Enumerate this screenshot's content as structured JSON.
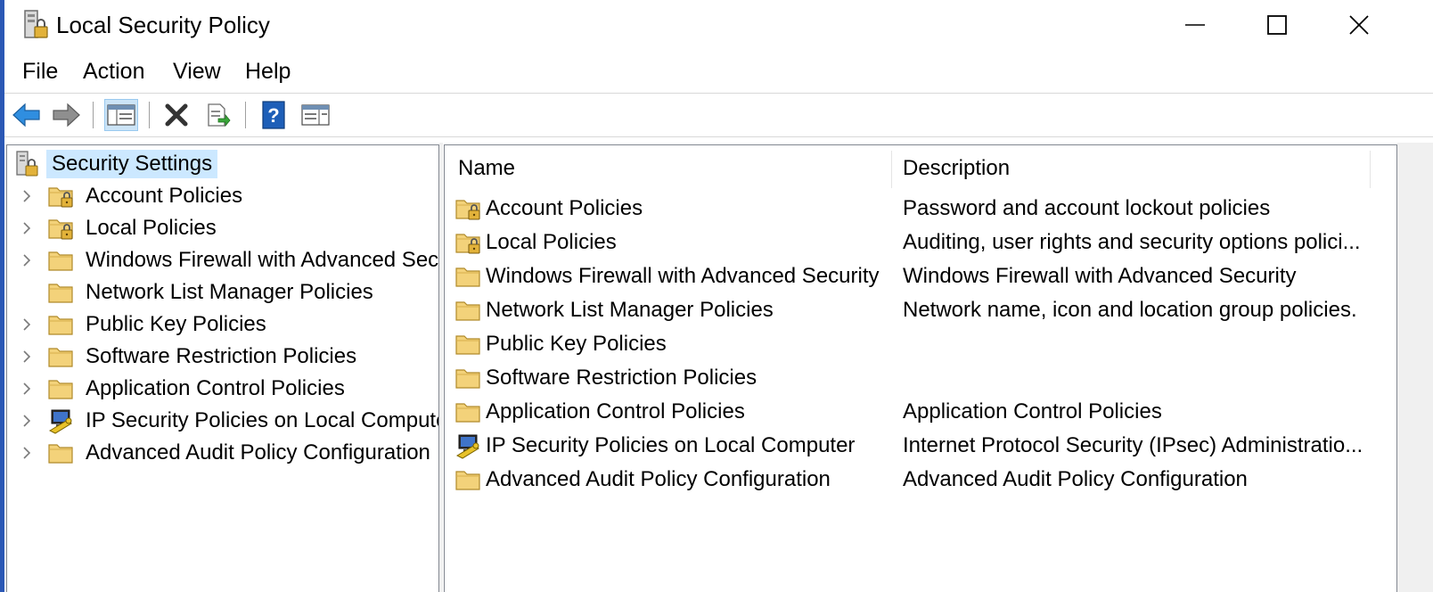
{
  "window": {
    "title": "Local Security Policy"
  },
  "menu": [
    "File",
    "Action",
    "View",
    "Help"
  ],
  "toolbar": {
    "buttons": [
      "back-icon",
      "forward-icon",
      "show-hide-console-tree-icon",
      "delete-icon",
      "export-list-icon",
      "help-icon",
      "properties-view-icon"
    ]
  },
  "tree": {
    "root": "Security Settings",
    "items": [
      {
        "label": "Account Policies",
        "expandable": true,
        "icon": "folder-lock-icon"
      },
      {
        "label": "Local Policies",
        "expandable": true,
        "icon": "folder-lock-icon"
      },
      {
        "label": "Windows Firewall with Advanced Secu",
        "expandable": true,
        "icon": "folder-icon"
      },
      {
        "label": "Network List Manager Policies",
        "expandable": false,
        "icon": "folder-icon"
      },
      {
        "label": "Public Key Policies",
        "expandable": true,
        "icon": "folder-icon"
      },
      {
        "label": "Software Restriction Policies",
        "expandable": true,
        "icon": "folder-icon"
      },
      {
        "label": "Application Control Policies",
        "expandable": true,
        "icon": "folder-icon"
      },
      {
        "label": "IP Security Policies on Local Compute",
        "expandable": true,
        "icon": "ip-security-icon"
      },
      {
        "label": "Advanced Audit Policy Configuration",
        "expandable": true,
        "icon": "folder-icon"
      }
    ]
  },
  "list": {
    "columns": [
      "Name",
      "Description"
    ],
    "rows": [
      {
        "name": "Account Policies",
        "description": "Password and account lockout policies",
        "icon": "folder-lock-icon"
      },
      {
        "name": "Local Policies",
        "description": "Auditing, user rights and security options polici...",
        "icon": "folder-lock-icon"
      },
      {
        "name": "Windows Firewall with Advanced Security",
        "description": "Windows Firewall with Advanced Security",
        "icon": "folder-icon"
      },
      {
        "name": "Network List Manager Policies",
        "description": "Network name, icon and location group policies.",
        "icon": "folder-icon"
      },
      {
        "name": "Public Key Policies",
        "description": "",
        "icon": "folder-icon"
      },
      {
        "name": "Software Restriction Policies",
        "description": "",
        "icon": "folder-icon"
      },
      {
        "name": "Application Control Policies",
        "description": "Application Control Policies",
        "icon": "folder-icon"
      },
      {
        "name": "IP Security Policies on Local Computer",
        "description": "Internet Protocol Security (IPsec) Administratio...",
        "icon": "ip-security-icon"
      },
      {
        "name": "Advanced Audit Policy Configuration",
        "description": "Advanced Audit Policy Configuration",
        "icon": "folder-icon"
      }
    ]
  },
  "colors": {
    "selection": "#cce8ff",
    "folder": "#e8c15a",
    "accent": "#2b58b5"
  }
}
